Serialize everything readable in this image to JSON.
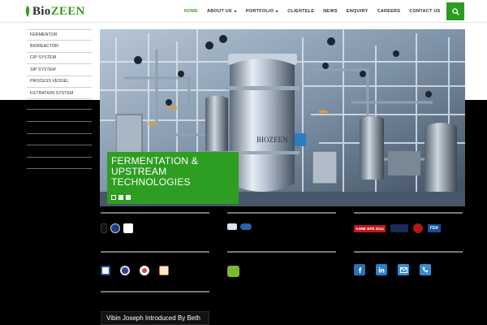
{
  "brand": {
    "logo_prefix": "Bio",
    "logo_suffix": "ZEEN"
  },
  "nav": {
    "items": [
      {
        "label": "HOME"
      },
      {
        "label": "ABOUT US"
      },
      {
        "label": "PORTFOLIO"
      },
      {
        "label": "CLIENTELE"
      },
      {
        "label": "NEWS"
      },
      {
        "label": "ENQUIRY"
      },
      {
        "label": "CAREERS"
      },
      {
        "label": "CONTACT US"
      }
    ],
    "active_color": "#3e9a1f"
  },
  "sidebar": {
    "items": [
      {
        "label": "FERMENTOR"
      },
      {
        "label": "BIOREACTOR"
      },
      {
        "label": "CIP SYSTEM"
      },
      {
        "label": "SIP SYSTEM"
      },
      {
        "label": "PROCESS VESSEL"
      },
      {
        "label": "FILTRATION SYSTEM"
      }
    ]
  },
  "slider": {
    "caption_line1": "FERMENTATION &",
    "caption_line2": "UPSTREAM",
    "caption_line3": "TECHNOLOGIES",
    "equipment_brand": "BIOZEEN",
    "caption_color": "#2e9e22"
  },
  "footer": {
    "news_ticker": "Vibin Joseph Introduced By Beth",
    "asme_badge": "ASME BPE 2014",
    "fda_badge": "FDA"
  }
}
